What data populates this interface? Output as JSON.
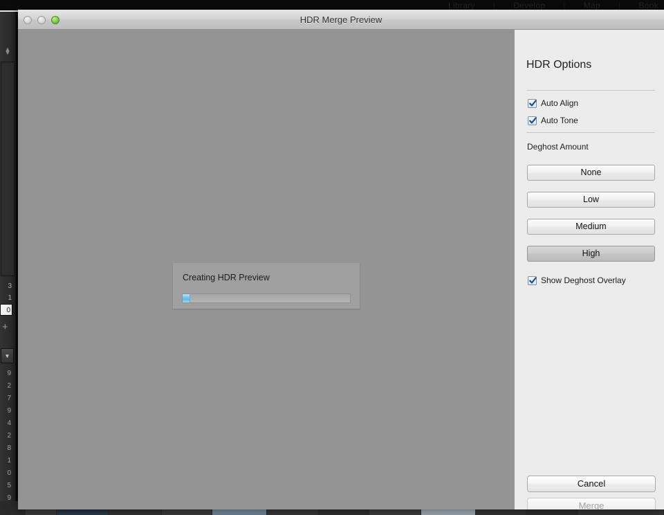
{
  "background_app": {
    "module_bar": [
      "Library",
      "|",
      "Develop",
      "|",
      "Map",
      "|",
      "Book"
    ],
    "left_panel": {
      "sort_icon": "sort-arrows-icon",
      "numbers_top": [
        "3",
        "1"
      ],
      "field_value": "0",
      "plus_icon": "plus-icon",
      "dropdown_icon": "triangle-down-icon",
      "numbers_bottom": [
        "9",
        "2",
        "7",
        "9",
        "4",
        "2",
        "8",
        "1",
        "0",
        "5",
        "9"
      ]
    }
  },
  "window": {
    "title": "HDR Merge Preview",
    "traffic_lights": {
      "close": "close-button",
      "minimize": "minimize-button",
      "zoom": "zoom-button"
    }
  },
  "progress_dialog": {
    "title": "Creating HDR Preview",
    "percent": 4
  },
  "options": {
    "panel_title": "HDR Options",
    "checkboxes": [
      {
        "label": "Auto Align",
        "checked": true
      },
      {
        "label": "Auto Tone",
        "checked": true
      }
    ],
    "deghost": {
      "label": "Deghost Amount",
      "options": [
        "None",
        "Low",
        "Medium",
        "High"
      ],
      "selected": "High"
    },
    "overlay_checkbox": {
      "label": "Show Deghost Overlay",
      "checked": true
    }
  },
  "footer": {
    "cancel_label": "Cancel",
    "merge_label": "Merge",
    "merge_enabled": false
  },
  "colors": {
    "canvas": "#949494",
    "panel": "#ececec",
    "progress_fill": "#5dbcec",
    "checkbox_tick": "#1f4f86"
  }
}
